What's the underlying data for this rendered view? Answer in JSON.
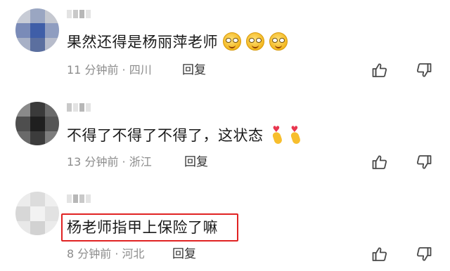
{
  "comments": [
    {
      "text": "果然还得是杨丽萍老师",
      "emoji": [
        "grinning-face-emoji",
        "grinning-face-emoji",
        "grinning-face-emoji"
      ],
      "meta": "11 分钟前 · 四川",
      "reply_label": "回复"
    },
    {
      "text": "不得了不得了不得了，这状态",
      "emoji": [
        "heart-fingers-emoji",
        "heart-fingers-emoji"
      ],
      "meta": "13 分钟前 · 浙江",
      "reply_label": "回复"
    },
    {
      "text": "杨老师指甲上保险了嘛",
      "emoji": [],
      "meta": "8 分钟前 · 河北",
      "reply_label": "回复",
      "highlighted": true
    }
  ],
  "colors": {
    "highlight_border": "#e02222",
    "meta_text": "#8c8c8c",
    "body_text": "#1a1a1a"
  },
  "icons": {
    "like": "thumbs-up-icon",
    "dislike": "thumbs-down-icon"
  }
}
